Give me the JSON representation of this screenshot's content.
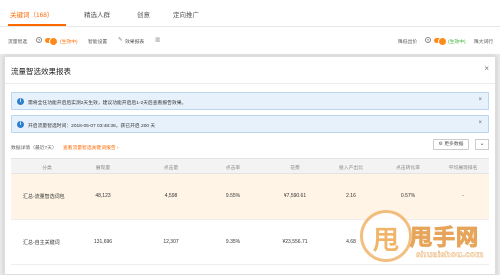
{
  "tabs": [
    {
      "label": "关键词（168）",
      "active": true
    },
    {
      "label": "精选人群",
      "active": false
    },
    {
      "label": "创意",
      "active": false
    },
    {
      "label": "定向推广",
      "active": false
    }
  ],
  "toolbar": {
    "smart_label": "流量智选",
    "smart_help": "?",
    "smart_status": "(生效中)",
    "smart_settings": "智能设置",
    "smart_report": "效果报表",
    "right_label": "降低出价",
    "right_help": "?",
    "right_status": "(生效中)",
    "right_tail": "降大词行"
  },
  "modal": {
    "title": "流量智选效果报表",
    "close": "×"
  },
  "notices": [
    {
      "icon": "i",
      "text": "需将全任功能开启后实测2天生效，建议功能开启后1-2天后查看报告效果。",
      "close": "×"
    },
    {
      "icon": "i",
      "text": "开启流量智选时间：2018-05-07 03:48:38，获已开启 200 天",
      "close": "×"
    }
  ],
  "data_line": {
    "label": "数据详情（最近7天）",
    "link": "查看流量智选关键词报告 ›"
  },
  "buttons": {
    "more": "更多数据",
    "chevron": "⌄"
  },
  "table": {
    "headers": [
      "分类",
      "展现量",
      "点击量",
      "点击率",
      "花费",
      "投入产出比",
      "点击转化率",
      "平均展现排名"
    ],
    "rows": [
      [
        "汇总-流量智选词包",
        "48,123",
        "4,598",
        "9.55%",
        "¥7,590.61",
        "2.16",
        "0.57%",
        "-"
      ],
      [
        "汇总-自主关键词",
        "131,696",
        "12,307",
        "9.35%",
        "¥23,556.71",
        "4.68",
        "",
        ""
      ]
    ]
  },
  "watermark": {
    "glyph": "甩",
    "name": "甩手网",
    "url": "shuaishou.com"
  },
  "colors": {
    "accent": "#ff6a00",
    "status_green": "#3cb034",
    "notice_bg": "#e7f1fb",
    "notice_icon": "#2f7fd1",
    "highlight_row": "#fff4e5"
  }
}
